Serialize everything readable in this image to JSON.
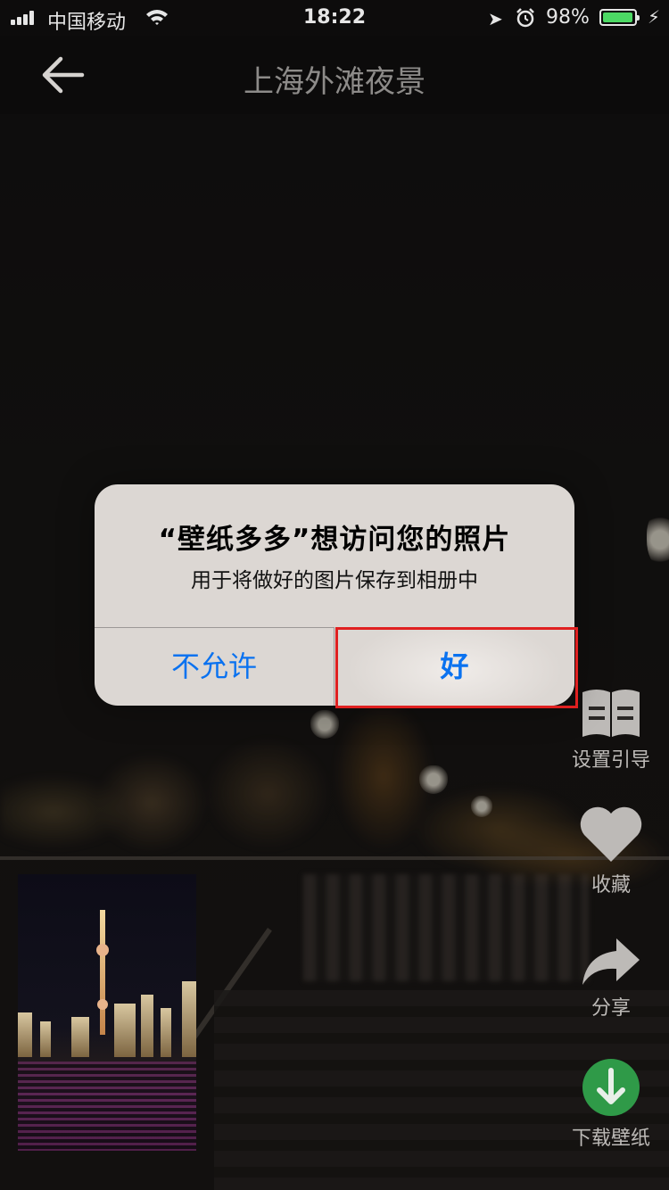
{
  "status_bar": {
    "carrier": "中国移动",
    "time": "18:22",
    "battery_text": "98%",
    "battery_level": 0.98,
    "icons": [
      "signal-icon",
      "wifi-icon",
      "location-arrow-icon",
      "alarm-clock-icon",
      "battery-icon",
      "charging-bolt-icon"
    ]
  },
  "nav": {
    "title": "上海外滩夜景",
    "back_icon": "back-arrow-icon"
  },
  "alert": {
    "title": "“壁纸多多”想访问您的照片",
    "message": "用于将做好的图片保存到相册中",
    "deny_label": "不允许",
    "allow_label": "好",
    "button_color": "#0a72f0",
    "highlight_color": "#e02020"
  },
  "tools": [
    {
      "label": "设置引导",
      "icon": "book-guide-icon"
    },
    {
      "label": "收藏",
      "icon": "heart-icon"
    },
    {
      "label": "分享",
      "icon": "share-arrow-icon"
    },
    {
      "label": "下载壁纸",
      "icon": "download-icon",
      "color": "#2f9a48"
    }
  ]
}
